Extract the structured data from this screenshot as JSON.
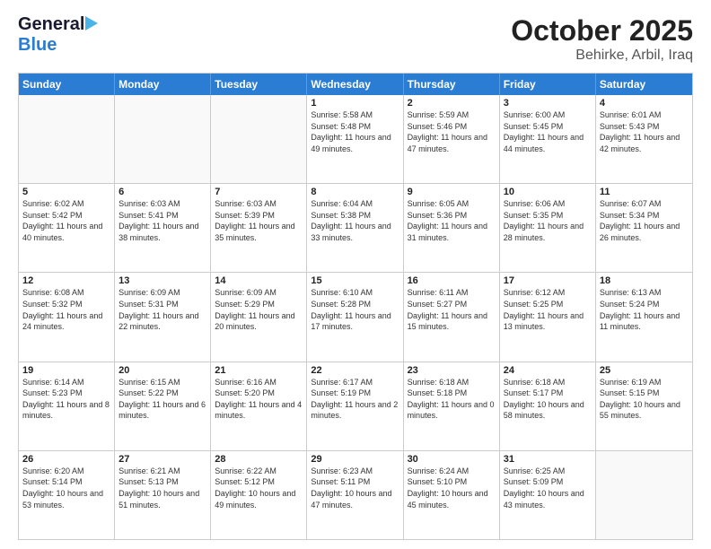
{
  "header": {
    "logo_general": "General",
    "logo_blue": "Blue",
    "month_title": "October 2025",
    "location": "Behirke, Arbil, Iraq"
  },
  "weekdays": [
    "Sunday",
    "Monday",
    "Tuesday",
    "Wednesday",
    "Thursday",
    "Friday",
    "Saturday"
  ],
  "weeks": [
    [
      {
        "day": "",
        "sunrise": "",
        "sunset": "",
        "daylight": "",
        "empty": true
      },
      {
        "day": "",
        "sunrise": "",
        "sunset": "",
        "daylight": "",
        "empty": true
      },
      {
        "day": "",
        "sunrise": "",
        "sunset": "",
        "daylight": "",
        "empty": true
      },
      {
        "day": "1",
        "sunrise": "Sunrise: 5:58 AM",
        "sunset": "Sunset: 5:48 PM",
        "daylight": "Daylight: 11 hours and 49 minutes."
      },
      {
        "day": "2",
        "sunrise": "Sunrise: 5:59 AM",
        "sunset": "Sunset: 5:46 PM",
        "daylight": "Daylight: 11 hours and 47 minutes."
      },
      {
        "day": "3",
        "sunrise": "Sunrise: 6:00 AM",
        "sunset": "Sunset: 5:45 PM",
        "daylight": "Daylight: 11 hours and 44 minutes."
      },
      {
        "day": "4",
        "sunrise": "Sunrise: 6:01 AM",
        "sunset": "Sunset: 5:43 PM",
        "daylight": "Daylight: 11 hours and 42 minutes."
      }
    ],
    [
      {
        "day": "5",
        "sunrise": "Sunrise: 6:02 AM",
        "sunset": "Sunset: 5:42 PM",
        "daylight": "Daylight: 11 hours and 40 minutes."
      },
      {
        "day": "6",
        "sunrise": "Sunrise: 6:03 AM",
        "sunset": "Sunset: 5:41 PM",
        "daylight": "Daylight: 11 hours and 38 minutes."
      },
      {
        "day": "7",
        "sunrise": "Sunrise: 6:03 AM",
        "sunset": "Sunset: 5:39 PM",
        "daylight": "Daylight: 11 hours and 35 minutes."
      },
      {
        "day": "8",
        "sunrise": "Sunrise: 6:04 AM",
        "sunset": "Sunset: 5:38 PM",
        "daylight": "Daylight: 11 hours and 33 minutes."
      },
      {
        "day": "9",
        "sunrise": "Sunrise: 6:05 AM",
        "sunset": "Sunset: 5:36 PM",
        "daylight": "Daylight: 11 hours and 31 minutes."
      },
      {
        "day": "10",
        "sunrise": "Sunrise: 6:06 AM",
        "sunset": "Sunset: 5:35 PM",
        "daylight": "Daylight: 11 hours and 28 minutes."
      },
      {
        "day": "11",
        "sunrise": "Sunrise: 6:07 AM",
        "sunset": "Sunset: 5:34 PM",
        "daylight": "Daylight: 11 hours and 26 minutes."
      }
    ],
    [
      {
        "day": "12",
        "sunrise": "Sunrise: 6:08 AM",
        "sunset": "Sunset: 5:32 PM",
        "daylight": "Daylight: 11 hours and 24 minutes."
      },
      {
        "day": "13",
        "sunrise": "Sunrise: 6:09 AM",
        "sunset": "Sunset: 5:31 PM",
        "daylight": "Daylight: 11 hours and 22 minutes."
      },
      {
        "day": "14",
        "sunrise": "Sunrise: 6:09 AM",
        "sunset": "Sunset: 5:29 PM",
        "daylight": "Daylight: 11 hours and 20 minutes."
      },
      {
        "day": "15",
        "sunrise": "Sunrise: 6:10 AM",
        "sunset": "Sunset: 5:28 PM",
        "daylight": "Daylight: 11 hours and 17 minutes."
      },
      {
        "day": "16",
        "sunrise": "Sunrise: 6:11 AM",
        "sunset": "Sunset: 5:27 PM",
        "daylight": "Daylight: 11 hours and 15 minutes."
      },
      {
        "day": "17",
        "sunrise": "Sunrise: 6:12 AM",
        "sunset": "Sunset: 5:25 PM",
        "daylight": "Daylight: 11 hours and 13 minutes."
      },
      {
        "day": "18",
        "sunrise": "Sunrise: 6:13 AM",
        "sunset": "Sunset: 5:24 PM",
        "daylight": "Daylight: 11 hours and 11 minutes."
      }
    ],
    [
      {
        "day": "19",
        "sunrise": "Sunrise: 6:14 AM",
        "sunset": "Sunset: 5:23 PM",
        "daylight": "Daylight: 11 hours and 8 minutes."
      },
      {
        "day": "20",
        "sunrise": "Sunrise: 6:15 AM",
        "sunset": "Sunset: 5:22 PM",
        "daylight": "Daylight: 11 hours and 6 minutes."
      },
      {
        "day": "21",
        "sunrise": "Sunrise: 6:16 AM",
        "sunset": "Sunset: 5:20 PM",
        "daylight": "Daylight: 11 hours and 4 minutes."
      },
      {
        "day": "22",
        "sunrise": "Sunrise: 6:17 AM",
        "sunset": "Sunset: 5:19 PM",
        "daylight": "Daylight: 11 hours and 2 minutes."
      },
      {
        "day": "23",
        "sunrise": "Sunrise: 6:18 AM",
        "sunset": "Sunset: 5:18 PM",
        "daylight": "Daylight: 11 hours and 0 minutes."
      },
      {
        "day": "24",
        "sunrise": "Sunrise: 6:18 AM",
        "sunset": "Sunset: 5:17 PM",
        "daylight": "Daylight: 10 hours and 58 minutes."
      },
      {
        "day": "25",
        "sunrise": "Sunrise: 6:19 AM",
        "sunset": "Sunset: 5:15 PM",
        "daylight": "Daylight: 10 hours and 55 minutes."
      }
    ],
    [
      {
        "day": "26",
        "sunrise": "Sunrise: 6:20 AM",
        "sunset": "Sunset: 5:14 PM",
        "daylight": "Daylight: 10 hours and 53 minutes."
      },
      {
        "day": "27",
        "sunrise": "Sunrise: 6:21 AM",
        "sunset": "Sunset: 5:13 PM",
        "daylight": "Daylight: 10 hours and 51 minutes."
      },
      {
        "day": "28",
        "sunrise": "Sunrise: 6:22 AM",
        "sunset": "Sunset: 5:12 PM",
        "daylight": "Daylight: 10 hours and 49 minutes."
      },
      {
        "day": "29",
        "sunrise": "Sunrise: 6:23 AM",
        "sunset": "Sunset: 5:11 PM",
        "daylight": "Daylight: 10 hours and 47 minutes."
      },
      {
        "day": "30",
        "sunrise": "Sunrise: 6:24 AM",
        "sunset": "Sunset: 5:10 PM",
        "daylight": "Daylight: 10 hours and 45 minutes."
      },
      {
        "day": "31",
        "sunrise": "Sunrise: 6:25 AM",
        "sunset": "Sunset: 5:09 PM",
        "daylight": "Daylight: 10 hours and 43 minutes."
      },
      {
        "day": "",
        "sunrise": "",
        "sunset": "",
        "daylight": "",
        "empty": true
      }
    ]
  ]
}
